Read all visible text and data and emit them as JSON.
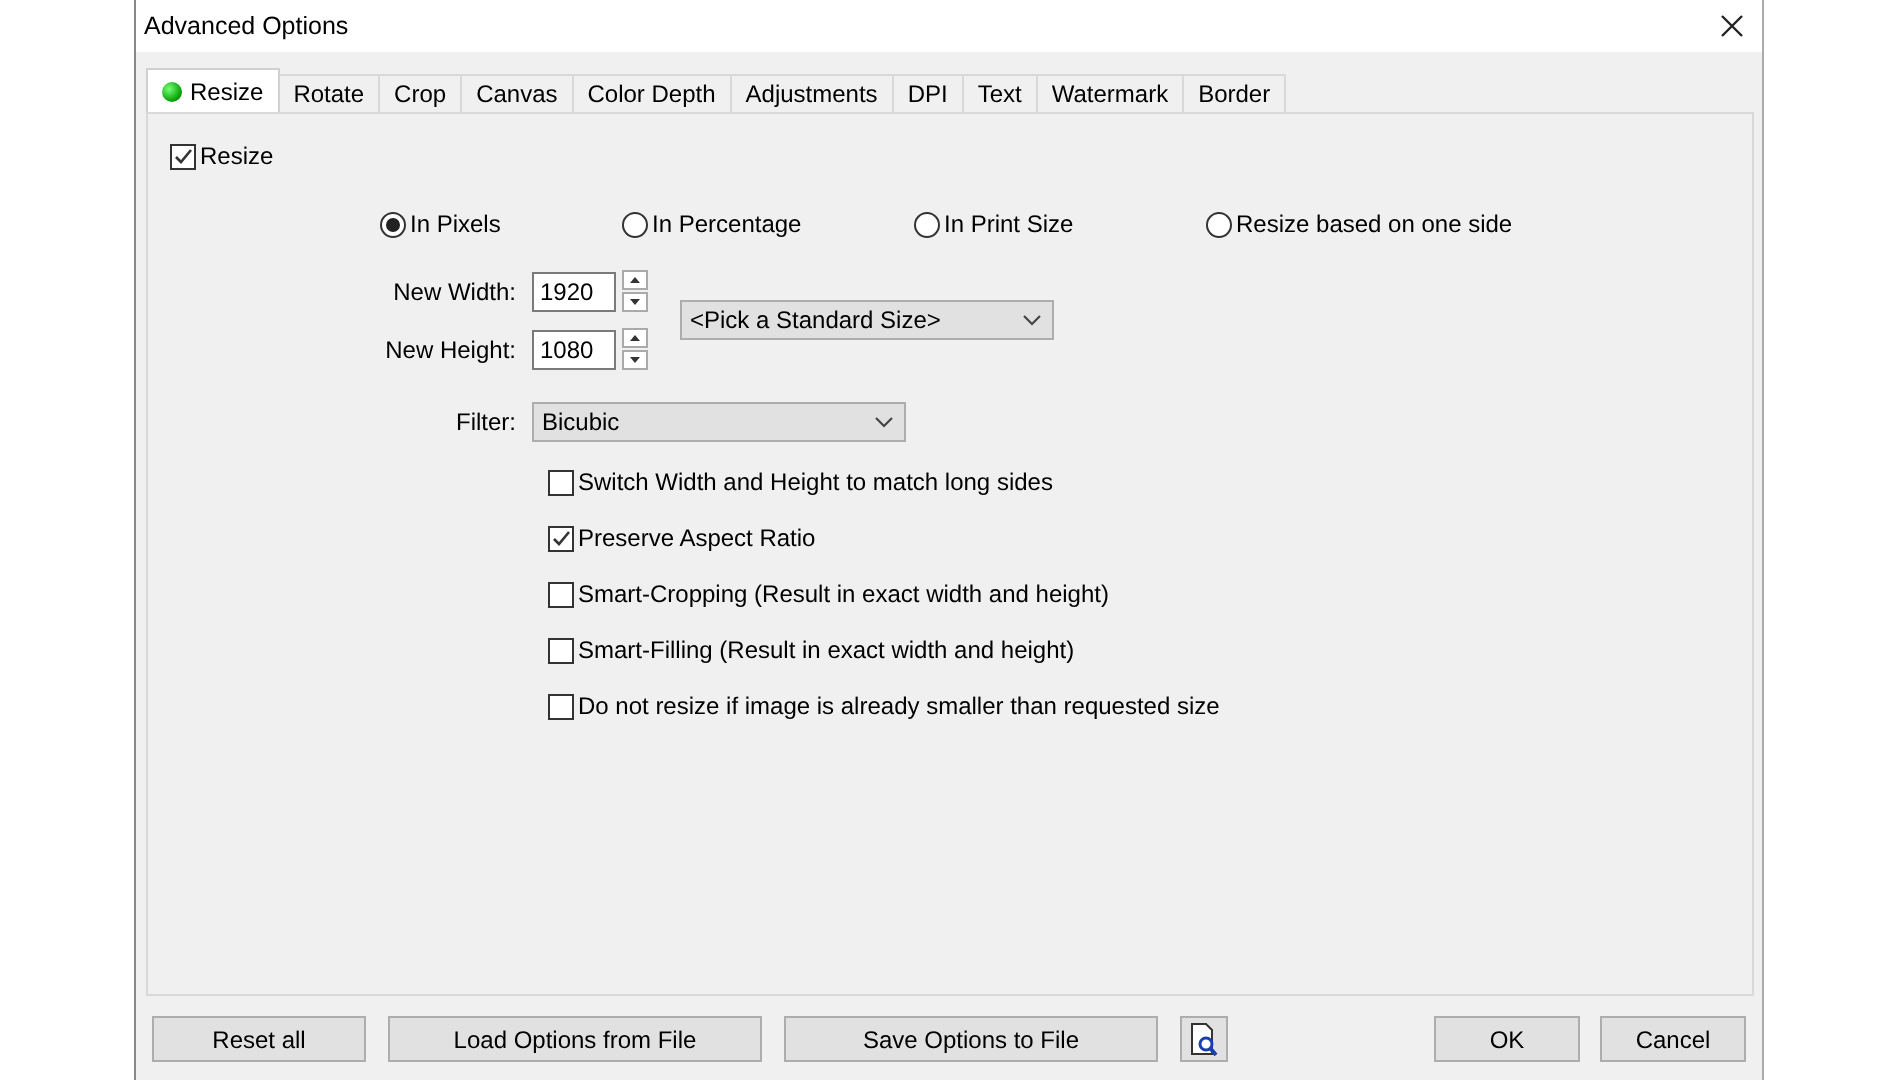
{
  "window": {
    "title": "Advanced Options"
  },
  "tabs": [
    {
      "label": "Resize",
      "selected": true,
      "active_dot": true
    },
    {
      "label": "Rotate",
      "selected": false,
      "active_dot": false
    },
    {
      "label": "Crop",
      "selected": false,
      "active_dot": false
    },
    {
      "label": "Canvas",
      "selected": false,
      "active_dot": false
    },
    {
      "label": "Color Depth",
      "selected": false,
      "active_dot": false
    },
    {
      "label": "Adjustments",
      "selected": false,
      "active_dot": false
    },
    {
      "label": "DPI",
      "selected": false,
      "active_dot": false
    },
    {
      "label": "Text",
      "selected": false,
      "active_dot": false
    },
    {
      "label": "Watermark",
      "selected": false,
      "active_dot": false
    },
    {
      "label": "Border",
      "selected": false,
      "active_dot": false
    }
  ],
  "resize": {
    "label": "Resize",
    "checked": true
  },
  "modes": [
    {
      "label": "In Pixels",
      "selected": true
    },
    {
      "label": "In Percentage",
      "selected": false
    },
    {
      "label": "In Print Size",
      "selected": false
    },
    {
      "label": "Resize based on one side",
      "selected": false
    }
  ],
  "new_width": {
    "label": "New Width:",
    "value": "1920"
  },
  "new_height": {
    "label": "New Height:",
    "value": "1080"
  },
  "standard_size": {
    "value": "<Pick a Standard Size>"
  },
  "filter": {
    "label": "Filter:",
    "value": "Bicubic"
  },
  "options": [
    {
      "label": "Switch Width and Height to match long sides",
      "checked": false
    },
    {
      "label": "Preserve Aspect Ratio",
      "checked": true
    },
    {
      "label": "Smart-Cropping (Result in exact width and height)",
      "checked": false
    },
    {
      "label": "Smart-Filling (Result in exact width and height)",
      "checked": false
    },
    {
      "label": "Do not resize if image is already smaller than requested size",
      "checked": false
    }
  ],
  "buttons": {
    "reset": "Reset all",
    "load": "Load Options from File",
    "save": "Save Options to File",
    "ok": "OK",
    "cancel": "Cancel"
  }
}
